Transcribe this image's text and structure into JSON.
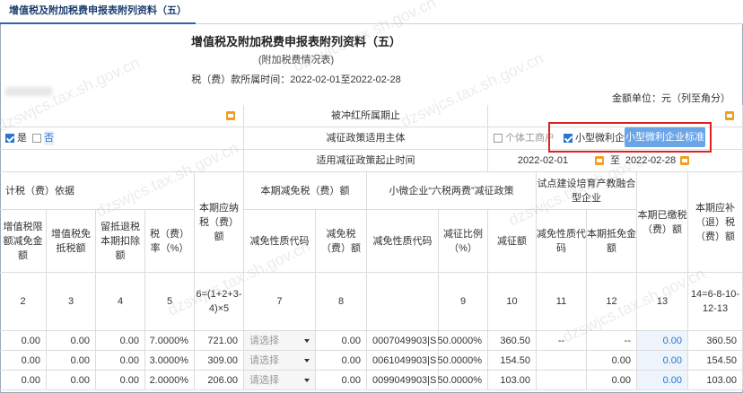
{
  "tab": {
    "label": "增值税及附加税费申报表附列资料（五）"
  },
  "header": {
    "title": "增值税及附加税费申报表附列资料（五）",
    "subtitle": "(附加税费情况表)",
    "period": "税（费）款所属时间：2022-02-01至2022-02-28",
    "unit": "金额单位：元（列至角分）"
  },
  "form": {
    "red_period_label": "被冲红所属期止",
    "subject_label": "减征政策适用主体",
    "individual_label": "个体工商户",
    "small_micro_label": "小型微利企业",
    "standard_button": "小型微利企业标准",
    "start_label": "适用减征政策起止时间",
    "start_date": "2022-02-01",
    "to_label": "至",
    "end_date": "2022-02-28",
    "yes_label": "是",
    "no_label": "否"
  },
  "table": {
    "group_basis": "计税（费）依据",
    "group_reduce": "本期减免税（费）额",
    "group_small": "小微企业“六税两费”减征政策",
    "group_pilot": "试点建设培育产教融合型企业",
    "headers": {
      "c1": "增值税限额减免金额",
      "c2": "增值税免抵税额",
      "c3": "留抵退税本期扣除额",
      "c4": "税（费）率（%）",
      "c5": "本期应纳税（费）额",
      "c6": "减免性质代码",
      "c7": "减免税（费）额",
      "c8": "减免性质代码",
      "c9": "减征比例（%）",
      "c10": "减征额",
      "c11": "减免性质代码",
      "c12": "本期抵免金额",
      "c13": "本期已缴税（费）额",
      "c14": "本期应补（退）税（费）额"
    },
    "col_numbers": [
      "2",
      "3",
      "4",
      "5",
      "6=(1+2+3-4)×5",
      "7",
      "8",
      "9",
      "10",
      "11",
      "12",
      "13",
      "14=6-8-10-12-13"
    ],
    "rows": [
      {
        "c1": "0.00",
        "c2": "0.00",
        "c3": "0.00",
        "rate": "7.0000%",
        "due": "721.00",
        "sel": "请选择",
        "reduce": "0.00",
        "code": "0007049903|S",
        "ratio": "50.0000%",
        "amount": "360.50",
        "pcode": "--",
        "pamt": "--",
        "paid": "0.00",
        "balance": "360.50"
      },
      {
        "c1": "0.00",
        "c2": "0.00",
        "c3": "0.00",
        "rate": "3.0000%",
        "due": "309.00",
        "sel": "请选择",
        "reduce": "0.00",
        "code": "0061049903|S",
        "ratio": "50.0000%",
        "amount": "154.50",
        "pcode": "",
        "pamt": "0.00",
        "paid": "0.00",
        "balance": "154.50"
      },
      {
        "c1": "0.00",
        "c2": "0.00",
        "c3": "0.00",
        "rate": "2.0000%",
        "due": "206.00",
        "sel": "请选择",
        "reduce": "0.00",
        "code": "0099049903|S",
        "ratio": "50.0000%",
        "amount": "103.00",
        "pcode": "",
        "pamt": "0.00",
        "paid": "0.00",
        "balance": "103.00"
      }
    ]
  },
  "watermark": "dzswjcs.tax.sh.gov.cn",
  "colors": {
    "accent": "#2b74c9",
    "button": "#6aa5e8",
    "highlight": "#e02020"
  }
}
